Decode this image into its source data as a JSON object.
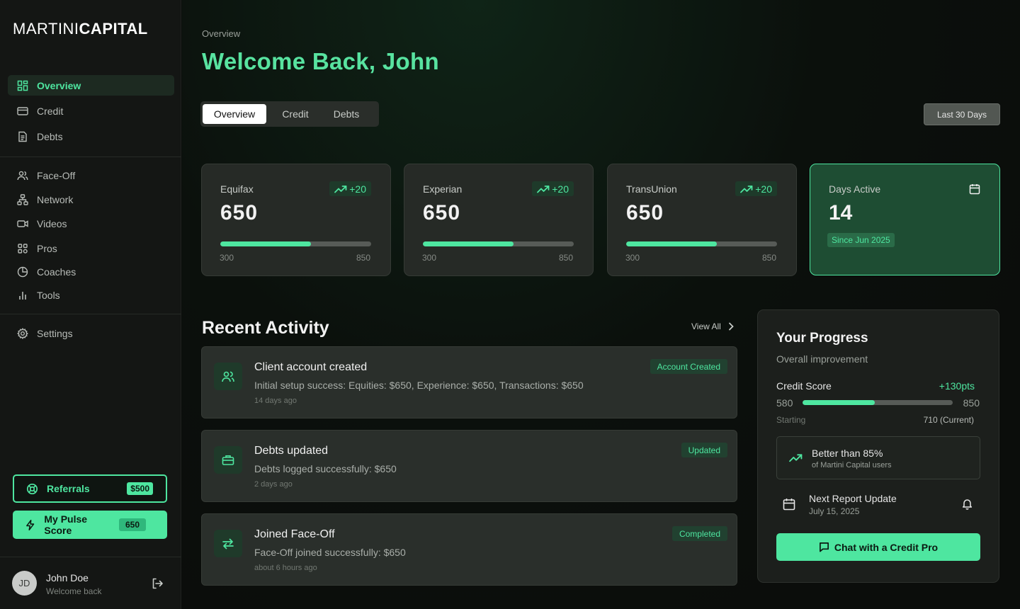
{
  "brand": {
    "thin": "MARTINI",
    "bold": "CAPITAL"
  },
  "sidebar": {
    "primary": [
      {
        "label": "Overview",
        "icon": "grid-icon",
        "active": true
      },
      {
        "label": "Credit",
        "icon": "credit-card-icon"
      },
      {
        "label": "Debts",
        "icon": "document-icon"
      }
    ],
    "secondary": [
      {
        "label": "Face-Off",
        "icon": "users-icon"
      },
      {
        "label": "Network",
        "icon": "network-icon"
      },
      {
        "label": "Videos",
        "icon": "video-icon"
      },
      {
        "label": "Pros",
        "icon": "pros-icon"
      },
      {
        "label": "Coaches",
        "icon": "pie-icon"
      },
      {
        "label": "Tools",
        "icon": "bar-icon"
      }
    ],
    "settings": {
      "label": "Settings",
      "icon": "gear-icon"
    },
    "referrals": {
      "label": "Referrals",
      "badge": "$500"
    },
    "pulse": {
      "label": "My Pulse Score",
      "badge": "650"
    },
    "user": {
      "initials": "JD",
      "name": "John Doe",
      "sub": "Welcome back"
    }
  },
  "header": {
    "breadcrumb": "Overview",
    "welcome": "Welcome Back, John",
    "tabs": [
      "Overview",
      "Credit",
      "Debts"
    ],
    "active_tab": "Overview",
    "range": "Last 30 Days"
  },
  "scores": [
    {
      "name": "Equifax",
      "delta": "+20",
      "value": "650",
      "min": "300",
      "max": "850",
      "progress": 0.6
    },
    {
      "name": "Experian",
      "delta": "+20",
      "value": "650",
      "min": "300",
      "max": "850",
      "progress": 0.6
    },
    {
      "name": "TransUnion",
      "delta": "+20",
      "value": "650",
      "min": "300",
      "max": "850",
      "progress": 0.6
    }
  ],
  "days": {
    "name": "Days Active",
    "value": "14",
    "since": "Since Jun 2025"
  },
  "activity": {
    "title": "Recent Activity",
    "view_all": "View All",
    "items": [
      {
        "title": "Client account created",
        "desc": "Initial setup success: Equities: $650, Experience: $650, Transactions: $650",
        "time": "14 days ago",
        "badge": "Account Created",
        "icon": "users-icon"
      },
      {
        "title": "Debts updated",
        "desc": "Debts logged successfully: $650",
        "time": "2 days ago",
        "badge": "Updated",
        "icon": "briefcase-icon"
      },
      {
        "title": "Joined Face-Off",
        "desc": "Face-Off joined successfully: $650",
        "time": "about 6 hours ago",
        "badge": "Completed",
        "icon": "swap-icon"
      }
    ]
  },
  "progress": {
    "title": "Your Progress",
    "subtitle": "Overall improvement",
    "label": "Credit Score",
    "points": "+130pts",
    "min": "580",
    "max": "850",
    "start_label": "Starting",
    "current_label": "710 (Current)",
    "fill": 0.48,
    "better_main": "Better than 85%",
    "better_sub": "of Martini Capital users",
    "next_main": "Next Report Update",
    "next_sub": "July 15, 2025",
    "chat": "Chat with a Credit Pro"
  },
  "colors": {
    "accent": "#4ee6a0",
    "bg": "#0b0d0b",
    "card": "#262a26"
  }
}
